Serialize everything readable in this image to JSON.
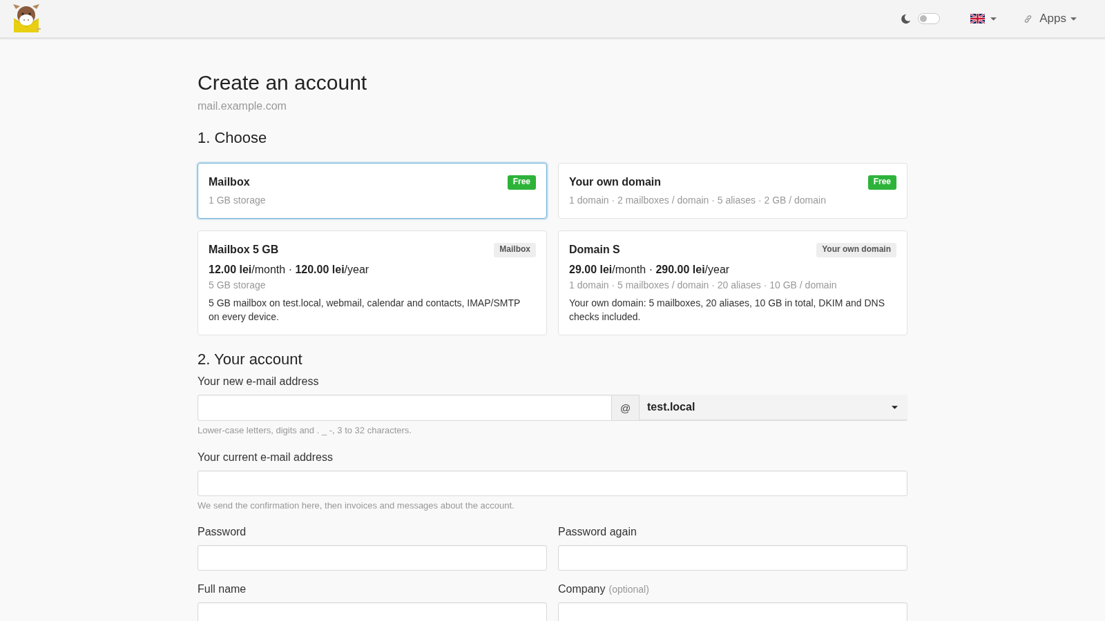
{
  "navbar": {
    "dark_mode_switch": {
      "on": false
    },
    "apps_menu": {
      "label": "Apps"
    }
  },
  "header": {
    "title": "Create an account",
    "subtitle": "mail.example.com"
  },
  "choose": {
    "heading": "1. Choose",
    "plans": [
      {
        "name": "Mailbox",
        "selected": true,
        "badge": {
          "text": "Free",
          "kind": "free"
        },
        "specs": "1 GB storage"
      },
      {
        "name": "Your own domain",
        "selected": false,
        "badge": {
          "text": "Free",
          "kind": "free"
        },
        "specs": "1 domain · 2 mailboxes / domain · 5 aliases · 2 GB / domain"
      },
      {
        "name": "Mailbox 5 GB",
        "selected": false,
        "badge": {
          "text": "Mailbox",
          "kind": "category"
        },
        "price": "**12.00 lei**/month · **120.00 lei**/year",
        "specs": "5 GB storage",
        "description": "5 GB mailbox on test.local, webmail, calendar and contacts, IMAP/SMTP on every device."
      },
      {
        "name": "Domain S",
        "selected": false,
        "badge": {
          "text": "Your own domain",
          "kind": "category"
        },
        "price": "**29.00 lei**/month · **290.00 lei**/year",
        "specs": "1 domain · 5 mailboxes / domain · 20 aliases · 10 GB / domain",
        "description": "Your own domain: 5 mailboxes, 20 aliases, 10 GB in total, DKIM and DNS checks included."
      }
    ]
  },
  "account": {
    "heading": "2. Your account",
    "new_email": {
      "label": "Your new e-mail address",
      "separator": "@",
      "domain": "test.local",
      "hint": "Lower-case letters, digits and . _ -, 3 to 32 characters."
    },
    "current_email": {
      "label": "Your current e-mail address",
      "hint": "We send the confirmation here, then invoices and messages about the account."
    },
    "password": {
      "label": "Password"
    },
    "password_again": {
      "label": "Password again"
    },
    "full_name": {
      "label": "Full name"
    },
    "company": {
      "label": "Company",
      "note": "(optional)"
    }
  }
}
